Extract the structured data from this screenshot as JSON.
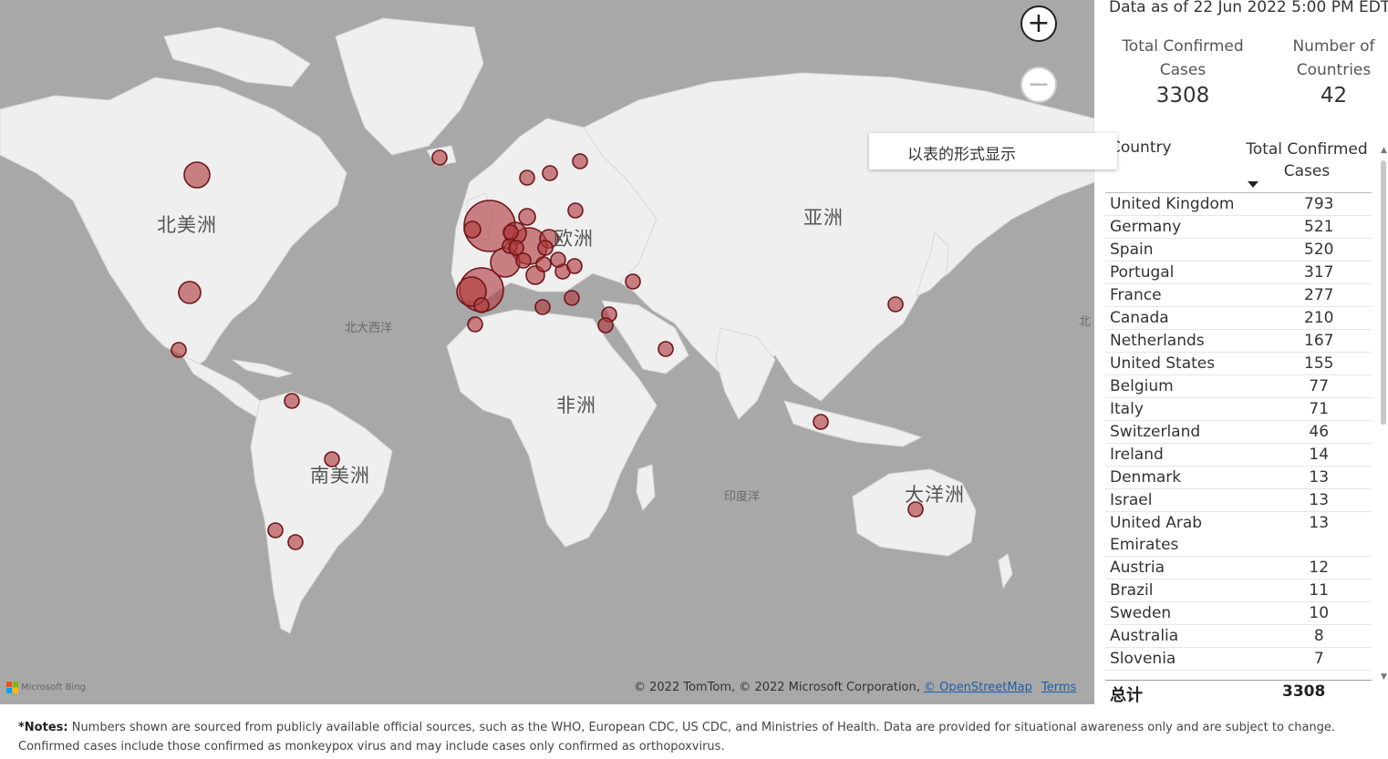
{
  "map": {
    "continent_labels": {
      "north_america": "北美洲",
      "south_america": "南美洲",
      "europe": "欧洲",
      "asia": "亚洲",
      "africa": "非洲",
      "oceania": "大洋洲"
    },
    "ocean_labels": {
      "north_atlantic": "北大西洋",
      "indian": "印度洋",
      "north_pacific_cut": "北"
    },
    "zoom_in_icon": "plus-icon",
    "zoom_out_icon": "minus-icon",
    "bing_logo_text": "Microsoft Bing",
    "attribution": {
      "text": "© 2022 TomTom, © 2022 Microsoft Corporation,",
      "osm_link": "© OpenStreetMap",
      "terms_link": "Terms"
    },
    "bubble_color": "#b03a3e",
    "bubble_stroke": "#6f1518"
  },
  "context_menu": {
    "show_as_table": "以表的形式显示"
  },
  "header": {
    "data_as_of": "Data as of 22 Jun 2022 5:00 PM EDT"
  },
  "kpis": {
    "total_cases_label": "Total Confirmed Cases",
    "total_cases_value": "3308",
    "countries_label": "Number of Countries",
    "countries_value": "42"
  },
  "table": {
    "col_country": "Country",
    "col_cases": "Total Confirmed Cases",
    "sort": "descending",
    "rows": [
      {
        "country": "United Kingdom",
        "cases": "793"
      },
      {
        "country": "Germany",
        "cases": "521"
      },
      {
        "country": "Spain",
        "cases": "520"
      },
      {
        "country": "Portugal",
        "cases": "317"
      },
      {
        "country": "France",
        "cases": "277"
      },
      {
        "country": "Canada",
        "cases": "210"
      },
      {
        "country": "Netherlands",
        "cases": "167"
      },
      {
        "country": "United States",
        "cases": "155"
      },
      {
        "country": "Belgium",
        "cases": "77"
      },
      {
        "country": "Italy",
        "cases": "71"
      },
      {
        "country": "Switzerland",
        "cases": "46"
      },
      {
        "country": "Ireland",
        "cases": "14"
      },
      {
        "country": "Denmark",
        "cases": "13"
      },
      {
        "country": "Israel",
        "cases": "13"
      },
      {
        "country": "United Arab Emirates",
        "cases": "13"
      },
      {
        "country": "Austria",
        "cases": "12"
      },
      {
        "country": "Brazil",
        "cases": "11"
      },
      {
        "country": "Sweden",
        "cases": "10"
      },
      {
        "country": "Australia",
        "cases": "8"
      },
      {
        "country": "Slovenia",
        "cases": "7"
      }
    ],
    "total_label": "总计",
    "total_value": "3308"
  },
  "notes": {
    "prefix": "*Notes:",
    "text": "Numbers shown are sourced from publicly available official sources, such as the WHO, European CDC, US CDC, and Ministries of Health. Data are provided for situational awareness only and are subject to change. Confirmed cases include those confirmed as monkeypox virus and may include cases only confirmed as orthopoxvirus."
  }
}
